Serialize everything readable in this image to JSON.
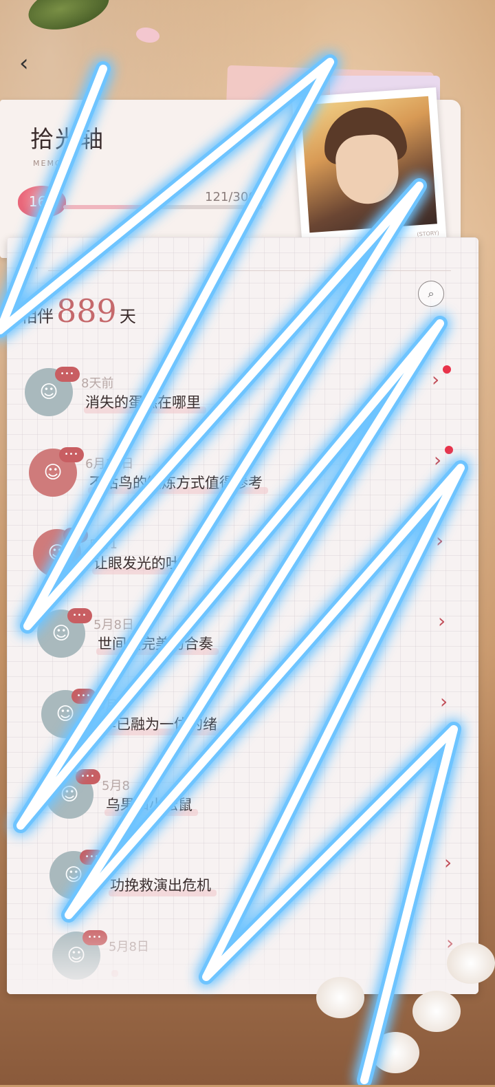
{
  "header": {
    "back_icon": "chevron-left-icon",
    "title": "拾光轴",
    "subtitle": "MEMORY",
    "level": "168",
    "progress_text": "121/3000",
    "progress": 0.4,
    "photo_tag": "(STORY)"
  },
  "days": {
    "prefix": "相伴",
    "number": "889",
    "suffix": "天"
  },
  "search": {
    "icon": "search-icon"
  },
  "timeline": [
    {
      "date": "8天前",
      "title": "消失的蛋糕在哪里",
      "avatar": "grey",
      "new": true,
      "bubble": "•••"
    },
    {
      "date": "6月12日",
      "title": "不咕鸟的锻炼方式值得参考",
      "avatar": "red",
      "new": true,
      "bubble": "•••"
    },
    {
      "date": "5月1",
      "title": "让眼发光的吐",
      "avatar": "red",
      "new": false,
      "bubble": "•••"
    },
    {
      "date": "5月8日",
      "title": "世间最完美的合奏",
      "avatar": "grey",
      "new": false,
      "bubble": "•••"
    },
    {
      "date": "5月8",
      "title": "早已融为一体的绪",
      "avatar": "grey",
      "new": false,
      "bubble": "•••"
    },
    {
      "date": "5月8",
      "title": "乌果和小松鼠",
      "avatar": "grey",
      "new": false,
      "bubble": "•••"
    },
    {
      "date": "日",
      "title": "功挽救演出危机",
      "avatar": "grey",
      "new": false,
      "bubble": "•••"
    },
    {
      "date": "5月8日",
      "title": "",
      "avatar": "grey",
      "new": false,
      "bubble": "•••"
    }
  ],
  "colors": {
    "accent": "#c5686b",
    "arrow": "#c24f5a",
    "new_dot": "#e8334a",
    "scribble": "#6ec4ff"
  }
}
